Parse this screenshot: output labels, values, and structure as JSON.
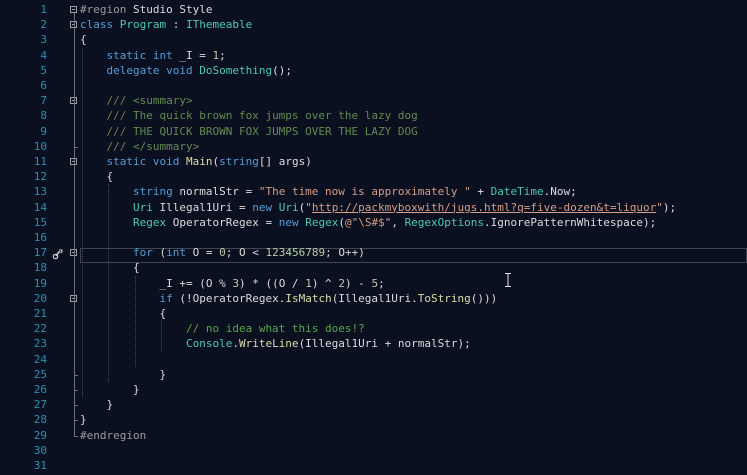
{
  "editor": {
    "line_numbers": [
      "1",
      "2",
      "3",
      "4",
      "5",
      "6",
      "7",
      "8",
      "9",
      "10",
      "11",
      "12",
      "13",
      "14",
      "15",
      "16",
      "17",
      "18",
      "19",
      "20",
      "21",
      "22",
      "23",
      "24",
      "25",
      "26",
      "27",
      "28",
      "29",
      "30",
      "31"
    ],
    "lines": [
      [
        {
          "t": "#region",
          "c": "pp"
        },
        {
          "t": " Studio Style",
          "c": "ppt"
        }
      ],
      [
        {
          "t": "class",
          "c": "kw"
        },
        {
          "t": " ",
          "c": "id"
        },
        {
          "t": "Program",
          "c": "ty"
        },
        {
          "t": " : ",
          "c": "id"
        },
        {
          "t": "IThemeable",
          "c": "ty"
        }
      ],
      [
        {
          "t": "{",
          "c": "id"
        }
      ],
      [
        {
          "t": "    ",
          "c": "id"
        },
        {
          "t": "static",
          "c": "kw"
        },
        {
          "t": " ",
          "c": "id"
        },
        {
          "t": "int",
          "c": "kw"
        },
        {
          "t": " _I = ",
          "c": "id"
        },
        {
          "t": "1",
          "c": "nm"
        },
        {
          "t": ";",
          "c": "id"
        }
      ],
      [
        {
          "t": "    ",
          "c": "id"
        },
        {
          "t": "delegate",
          "c": "kw"
        },
        {
          "t": " ",
          "c": "id"
        },
        {
          "t": "void",
          "c": "kw"
        },
        {
          "t": " ",
          "c": "id"
        },
        {
          "t": "DoSomething",
          "c": "ty"
        },
        {
          "t": "();",
          "c": "id"
        }
      ],
      [],
      [
        {
          "t": "    ",
          "c": "id"
        },
        {
          "t": "/// ",
          "c": "dc"
        },
        {
          "t": "<summary>",
          "c": "dt"
        }
      ],
      [
        {
          "t": "    ",
          "c": "id"
        },
        {
          "t": "/// The quick brown fox jumps over the lazy dog",
          "c": "dc"
        }
      ],
      [
        {
          "t": "    ",
          "c": "id"
        },
        {
          "t": "/// THE QUICK BROWN FOX JUMPS OVER THE LAZY DOG",
          "c": "dc"
        }
      ],
      [
        {
          "t": "    ",
          "c": "id"
        },
        {
          "t": "/// ",
          "c": "dc"
        },
        {
          "t": "</summary>",
          "c": "dt"
        }
      ],
      [
        {
          "t": "    ",
          "c": "id"
        },
        {
          "t": "static",
          "c": "kw"
        },
        {
          "t": " ",
          "c": "id"
        },
        {
          "t": "void",
          "c": "kw"
        },
        {
          "t": " ",
          "c": "id"
        },
        {
          "t": "Main",
          "c": "mt"
        },
        {
          "t": "(",
          "c": "id"
        },
        {
          "t": "string",
          "c": "kw"
        },
        {
          "t": "[] args)",
          "c": "id"
        }
      ],
      [
        {
          "t": "    {",
          "c": "id"
        }
      ],
      [
        {
          "t": "        ",
          "c": "id"
        },
        {
          "t": "string",
          "c": "kw"
        },
        {
          "t": " normalStr = ",
          "c": "id"
        },
        {
          "t": "\"The time now is approximately \"",
          "c": "st"
        },
        {
          "t": " + ",
          "c": "id"
        },
        {
          "t": "DateTime",
          "c": "ty"
        },
        {
          "t": ".",
          "c": "id"
        },
        {
          "t": "Now",
          "c": "id"
        },
        {
          "t": ";",
          "c": "id"
        }
      ],
      [
        {
          "t": "        ",
          "c": "id"
        },
        {
          "t": "Uri",
          "c": "ty"
        },
        {
          "t": " Illegal1Uri = ",
          "c": "id"
        },
        {
          "t": "new",
          "c": "kw"
        },
        {
          "t": " ",
          "c": "id"
        },
        {
          "t": "Uri",
          "c": "ty"
        },
        {
          "t": "(",
          "c": "id"
        },
        {
          "t": "\"",
          "c": "st"
        },
        {
          "t": "http://packmyboxwith/jugs.html?q=five-dozen&t=liquor",
          "c": "st ul"
        },
        {
          "t": "\"",
          "c": "st"
        },
        {
          "t": ");",
          "c": "id"
        }
      ],
      [
        {
          "t": "        ",
          "c": "id"
        },
        {
          "t": "Regex",
          "c": "ty"
        },
        {
          "t": " OperatorRegex = ",
          "c": "id"
        },
        {
          "t": "new",
          "c": "kw"
        },
        {
          "t": " ",
          "c": "id"
        },
        {
          "t": "Regex",
          "c": "ty"
        },
        {
          "t": "(",
          "c": "id"
        },
        {
          "t": "@\"\\S#$\"",
          "c": "st"
        },
        {
          "t": ", ",
          "c": "id"
        },
        {
          "t": "RegexOptions",
          "c": "ty"
        },
        {
          "t": ".",
          "c": "id"
        },
        {
          "t": "IgnorePatternWhitespace",
          "c": "id"
        },
        {
          "t": ");",
          "c": "id"
        }
      ],
      [],
      [
        {
          "t": "        ",
          "c": "id"
        },
        {
          "t": "for",
          "c": "kw"
        },
        {
          "t": " (",
          "c": "id"
        },
        {
          "t": "int",
          "c": "kw"
        },
        {
          "t": " O = ",
          "c": "id"
        },
        {
          "t": "0",
          "c": "nm"
        },
        {
          "t": "; O < ",
          "c": "id"
        },
        {
          "t": "123456789",
          "c": "nm"
        },
        {
          "t": "; O++)",
          "c": "id"
        }
      ],
      [
        {
          "t": "        {",
          "c": "id"
        }
      ],
      [
        {
          "t": "            _I += (O % ",
          "c": "id"
        },
        {
          "t": "3",
          "c": "nm"
        },
        {
          "t": ") * ((O / ",
          "c": "id"
        },
        {
          "t": "1",
          "c": "nm"
        },
        {
          "t": ") ^ ",
          "c": "id"
        },
        {
          "t": "2",
          "c": "nm"
        },
        {
          "t": ") - ",
          "c": "id"
        },
        {
          "t": "5",
          "c": "nm"
        },
        {
          "t": ";",
          "c": "id"
        }
      ],
      [
        {
          "t": "            ",
          "c": "id"
        },
        {
          "t": "if",
          "c": "kw"
        },
        {
          "t": " (!OperatorRegex.",
          "c": "id"
        },
        {
          "t": "IsMatch",
          "c": "mt"
        },
        {
          "t": "(Illegal1Uri.",
          "c": "id"
        },
        {
          "t": "ToString",
          "c": "mt"
        },
        {
          "t": "()))",
          "c": "id"
        }
      ],
      [
        {
          "t": "            {",
          "c": "id"
        }
      ],
      [
        {
          "t": "                ",
          "c": "id"
        },
        {
          "t": "// no idea what this does!?",
          "c": "cm"
        }
      ],
      [
        {
          "t": "                ",
          "c": "id"
        },
        {
          "t": "Console",
          "c": "ty"
        },
        {
          "t": ".",
          "c": "id"
        },
        {
          "t": "WriteLine",
          "c": "mt"
        },
        {
          "t": "(Illegal1Uri + normalStr);",
          "c": "id"
        }
      ],
      [],
      [
        {
          "t": "            }",
          "c": "id"
        }
      ],
      [
        {
          "t": "        }",
          "c": "id"
        }
      ],
      [
        {
          "t": "    }",
          "c": "id"
        }
      ],
      [
        {
          "t": "}",
          "c": "id"
        }
      ],
      [
        {
          "t": "#endregion",
          "c": "pp"
        }
      ],
      [],
      []
    ],
    "colors": {
      "background": "#0b1021",
      "line_number": "#2b91af",
      "keyword": "#569cd6",
      "type": "#4ec9b0",
      "string": "#d69d85",
      "comment": "#57a64a",
      "number": "#b5cea8"
    },
    "icons": {
      "quick_action": "lightbulb-wrench-icon",
      "cursor": "ibeam-cursor-icon"
    }
  }
}
